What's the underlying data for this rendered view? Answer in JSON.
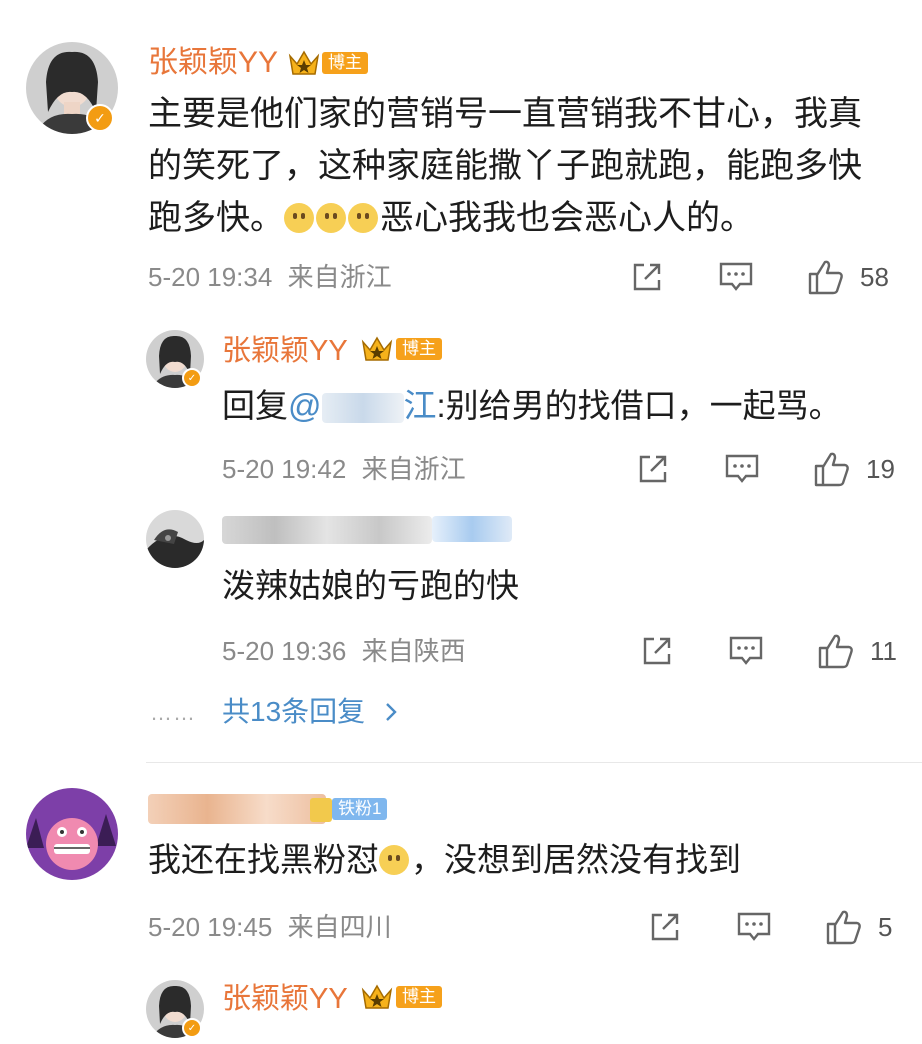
{
  "comments": [
    {
      "username": "张颖颖YY",
      "tag": "博主",
      "content_lines": [
        "主要是他们家的营销号一直营销我不甘心，我真",
        "的笑死了，这种家庭能撒丫子跑就跑，能跑多快",
        "跑多快。",
        "恶心我我也会恶心人的。"
      ],
      "time": "5-20 19:34",
      "location": "来自浙江",
      "likes": "58",
      "replies": [
        {
          "username": "张颖颖YY",
          "tag": "博主",
          "reply_prefix": "回复",
          "mention": "@",
          "mention_visible": "江",
          "content": ":别给男的找借口，一起骂。",
          "time": "5-20 19:42",
          "location": "来自浙江",
          "likes": "19"
        },
        {
          "username": "",
          "content": "泼辣姑娘的亏跑的快",
          "time": "5-20 19:36",
          "location": "来自陕西",
          "likes": "11"
        }
      ],
      "more_replies": "共13条回复",
      "more_dots": "……"
    },
    {
      "username": "",
      "fan_tag": "铁粉1",
      "content_before_emoji": "我还在找黑粉怼",
      "content_after_emoji": "，没想到居然没有找到",
      "time": "5-20 19:45",
      "location": "来自四川",
      "likes": "5",
      "replies": [
        {
          "username": "张颖颖YY",
          "tag": "博主"
        }
      ]
    }
  ],
  "icons": {
    "share": "share-icon",
    "comment": "comment-icon",
    "like": "thumbs-up-icon",
    "verified": "verified-badge-icon",
    "crown": "crown-icon",
    "chevron": "chevron-right-icon"
  },
  "colors": {
    "username": "#e8763a",
    "tag": "#f6a11b",
    "link": "#4a8cc7",
    "meta": "#8a8a8a"
  }
}
